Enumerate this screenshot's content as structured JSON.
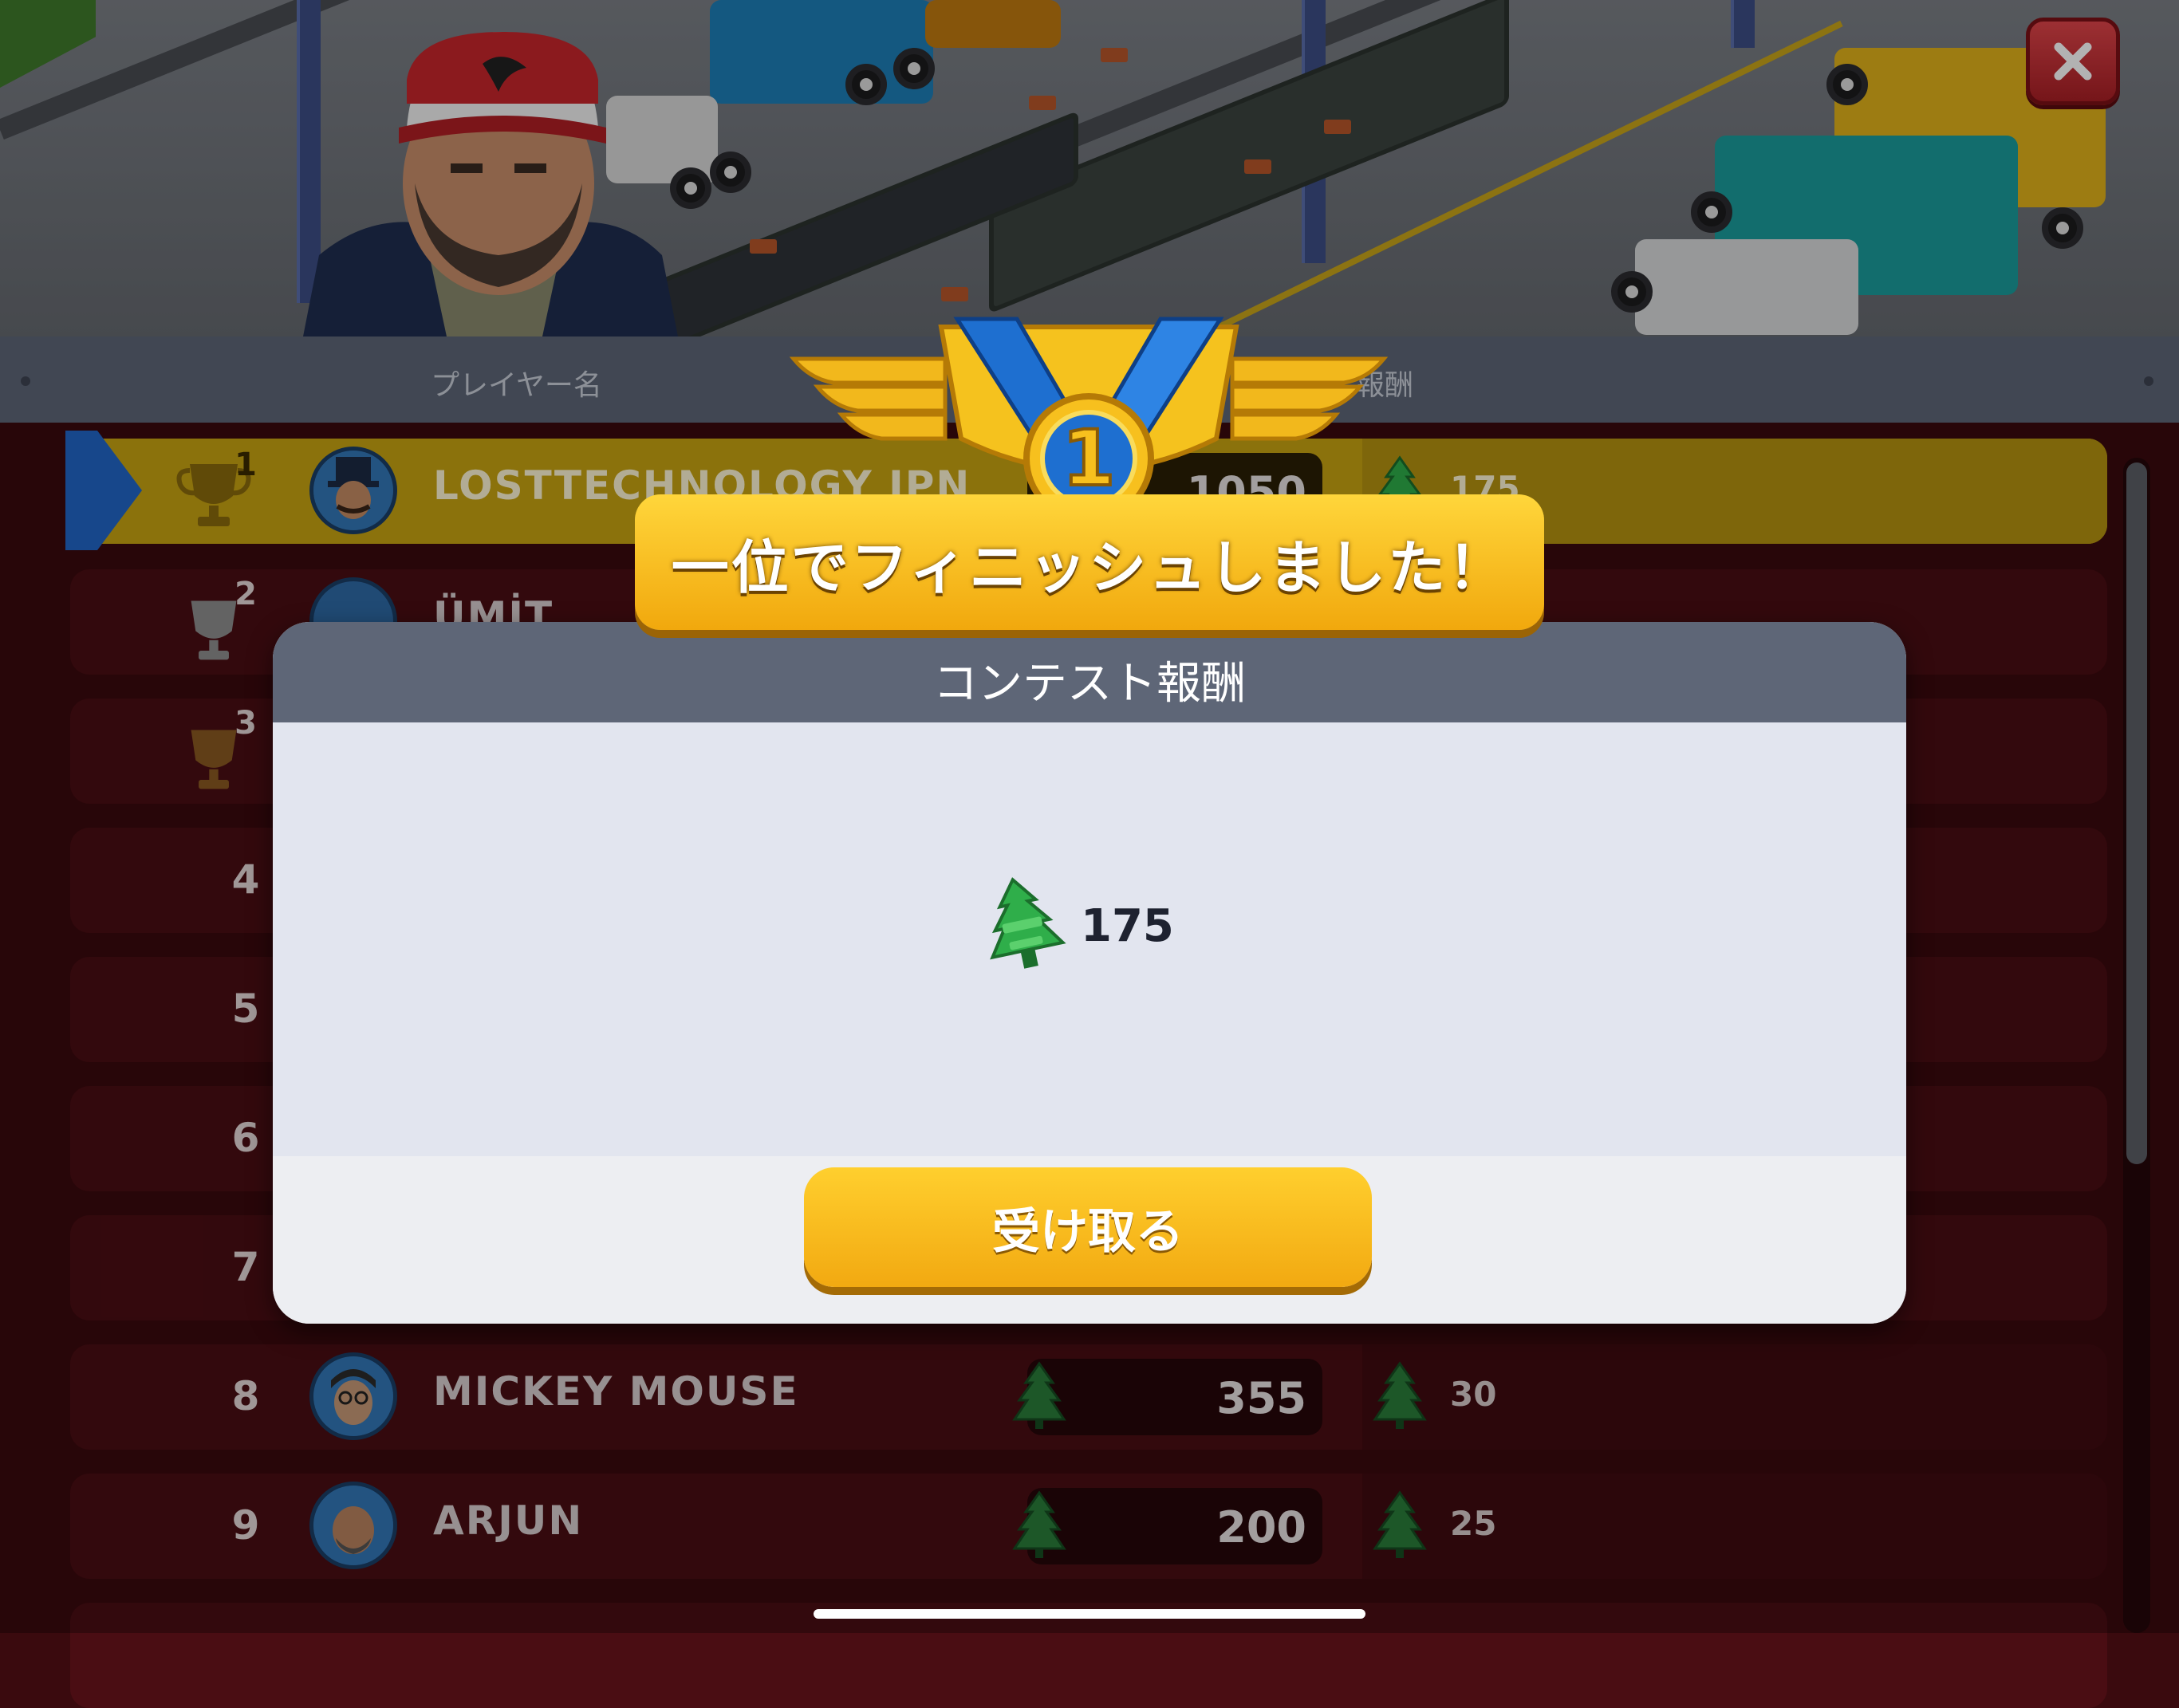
{
  "window": {
    "close_icon": "close-icon"
  },
  "header": {
    "col_player": "プレイヤー名",
    "col_reward": "報酬"
  },
  "leaderboard": {
    "rows": [
      {
        "rank": "1",
        "name": "LOSTTECHNOLOGY JPN",
        "score": "1050",
        "reward": "175",
        "trophy": "gold-trophy-icon"
      },
      {
        "rank": "2",
        "name": "ÜMİT",
        "score": "",
        "reward": "",
        "trophy": "silver-trophy-icon"
      },
      {
        "rank": "3",
        "name": "",
        "score": "",
        "reward": "",
        "trophy": "bronze-trophy-icon"
      },
      {
        "rank": "4",
        "name": "",
        "score": "",
        "reward": ""
      },
      {
        "rank": "5",
        "name": "",
        "score": "",
        "reward": ""
      },
      {
        "rank": "6",
        "name": "",
        "score": "",
        "reward": ""
      },
      {
        "rank": "7",
        "name": "",
        "score": "",
        "reward": ""
      },
      {
        "rank": "8",
        "name": "MICKEY MOUSE",
        "score": "355",
        "reward": "30"
      },
      {
        "rank": "9",
        "name": "ARJUN",
        "score": "200",
        "reward": "25"
      }
    ]
  },
  "banner": {
    "text": "一位でフィニッシュしました！",
    "medal_number": "1",
    "medal_icon": "gold-medal-icon"
  },
  "modal": {
    "title": "コンテスト報酬",
    "reward_value": "175",
    "reward_icon": "air-freshener-tree-icon",
    "claim_label": "受け取る"
  },
  "colors": {
    "header": "#5e6677",
    "row": "#4a0d13",
    "highlight_row": "#c8a412",
    "button": "#f7b81a",
    "close": "#d4343a",
    "tree": "#2fae4a"
  }
}
